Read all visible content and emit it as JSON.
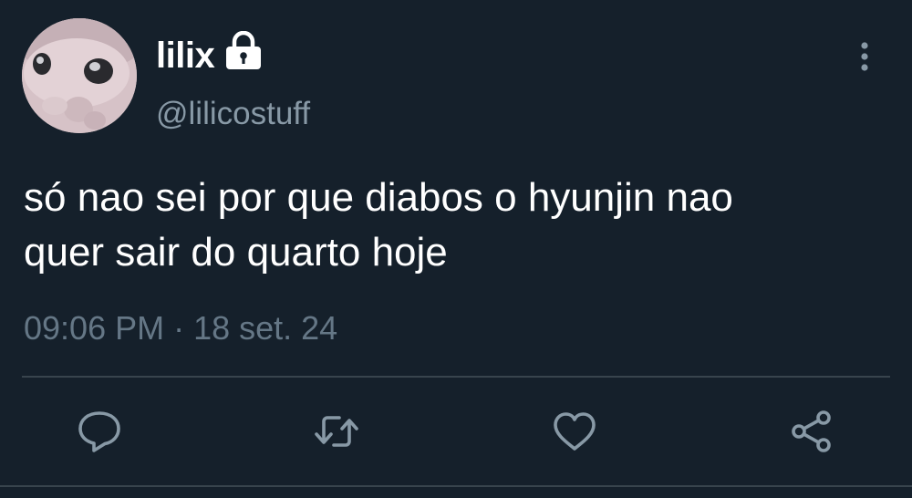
{
  "tweet": {
    "author": {
      "display_name": "lilix",
      "handle": "@lilicostuff",
      "protected_icon": "lock-icon",
      "avatar_icon": "avatar"
    },
    "text": "só nao sei por que diabos o hyunjin nao\nquer sair do quarto hoje",
    "timestamp": "09:06 PM · 18 set. 24",
    "menu_icon": "more-vertical-icon",
    "actions": [
      {
        "name": "reply",
        "icon": "reply-icon"
      },
      {
        "name": "retweet",
        "icon": "retweet-icon"
      },
      {
        "name": "like",
        "icon": "heart-icon"
      },
      {
        "name": "share",
        "icon": "share-icon"
      }
    ]
  },
  "colors": {
    "background": "#15202b",
    "primary_text": "#ffffff",
    "secondary_text": "#8899a6",
    "icon": "#8899a6",
    "divider": "#38444d"
  }
}
